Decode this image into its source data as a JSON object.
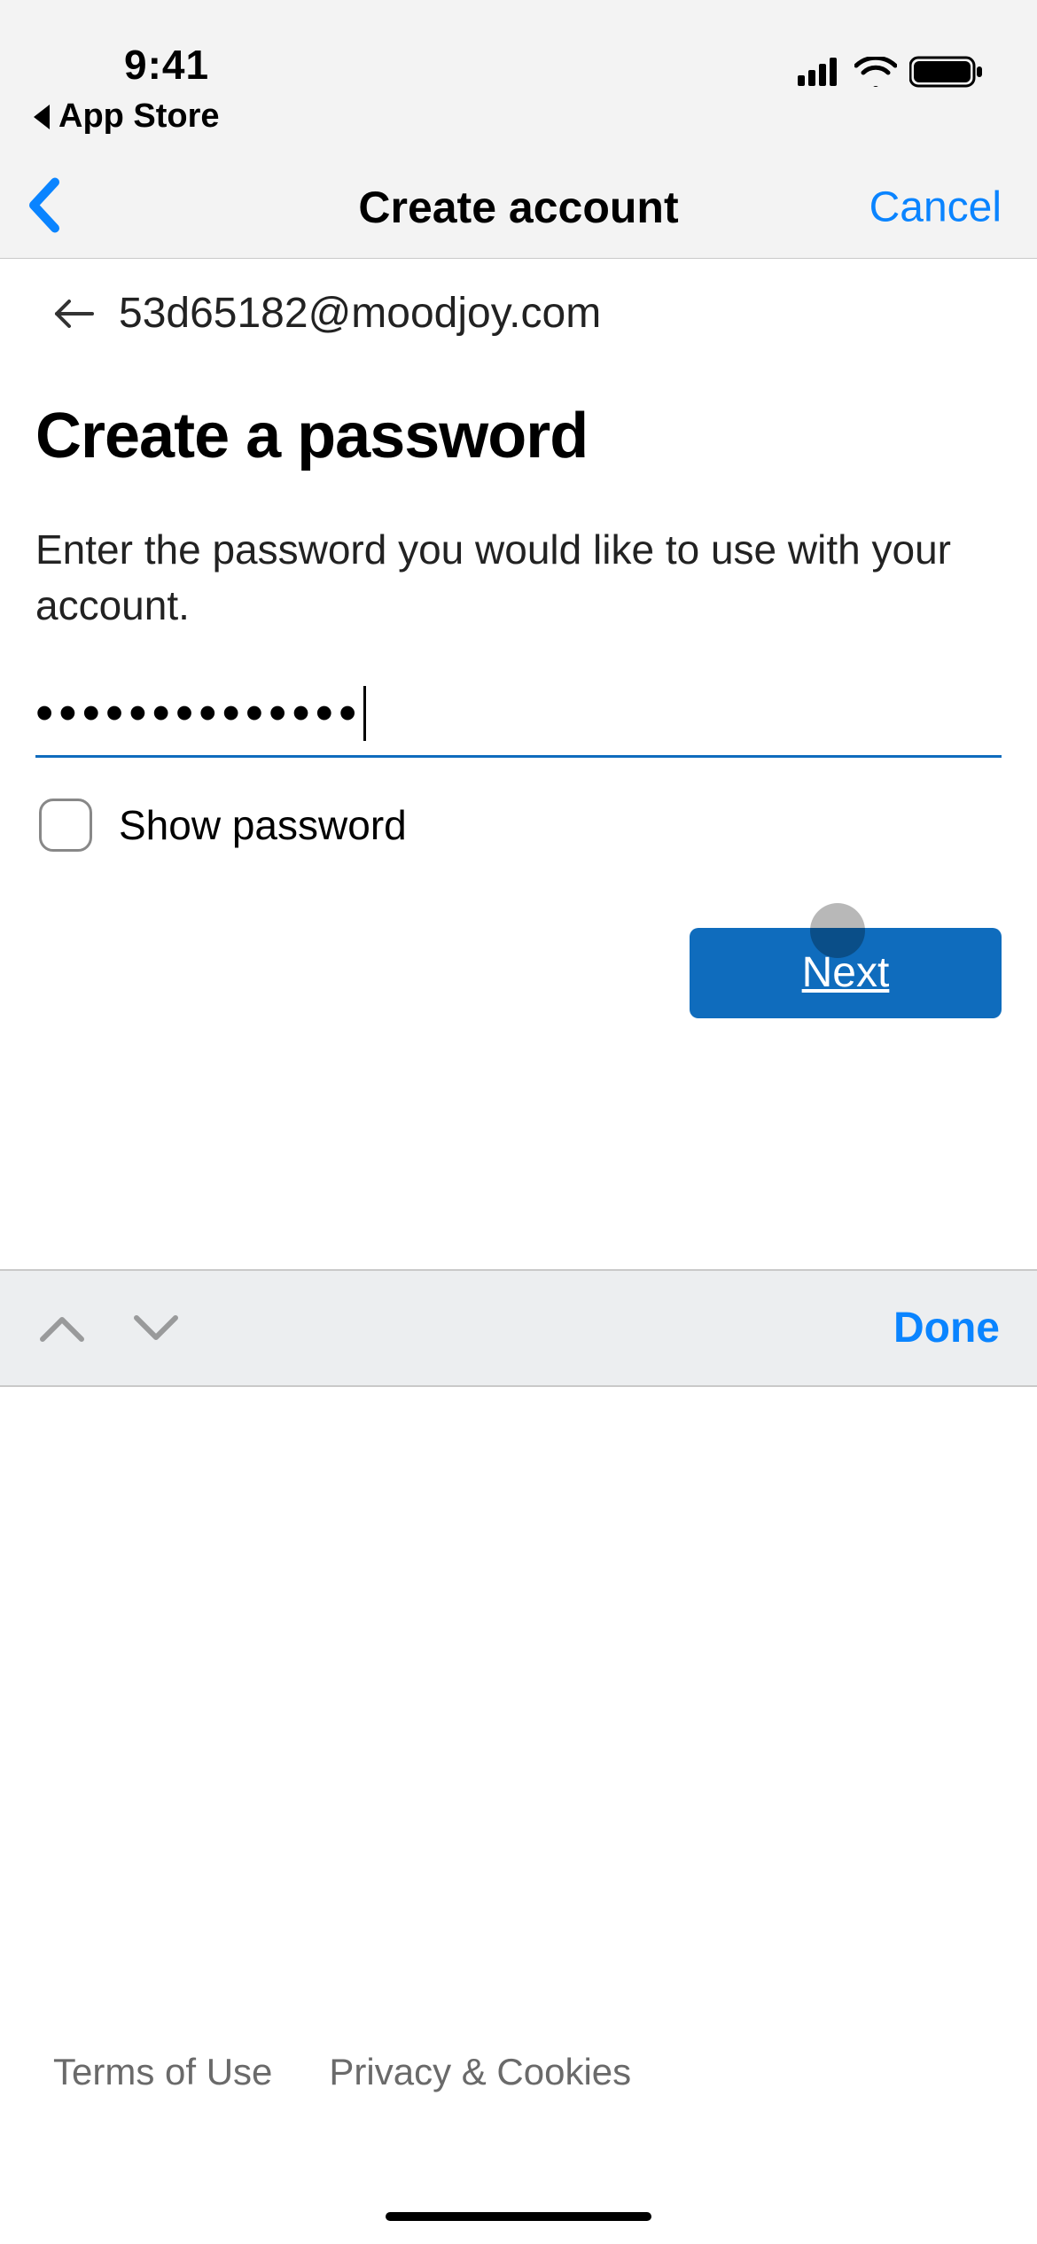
{
  "status": {
    "time": "9:41",
    "breadcrumb_label": "App Store"
  },
  "nav": {
    "title": "Create account",
    "cancel_label": "Cancel"
  },
  "form": {
    "email": "53d65182@moodjoy.com",
    "heading": "Create a password",
    "instruction": "Enter the password you would like to use with your account.",
    "password_mask": "••••••••••••••",
    "show_password_label": "Show password",
    "next_label": "Next"
  },
  "keyboard": {
    "done_label": "Done"
  },
  "footer": {
    "terms_label": "Terms of Use",
    "privacy_label": "Privacy & Cookies"
  }
}
